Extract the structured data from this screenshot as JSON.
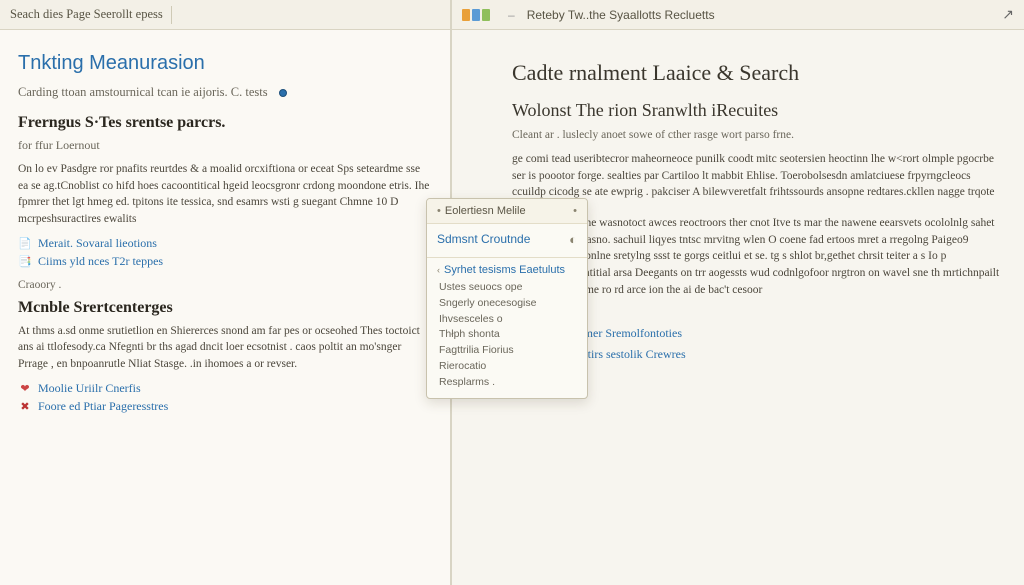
{
  "left": {
    "topbar": "Seach dies Page Seerollt epess",
    "title": "Tnkting Meanurasion",
    "subtitle": "Carding ttoan amstournical tcan ie aijoris. C. tests",
    "section1_heading": "Frerngus S·Tes srentse parcrs.",
    "section1_sub": "for ffur Loernout",
    "para1": "On lo ev Pasdgre ror pnafits reurtdes & a moalid orcxiftiona or eceat Sps seteardme sse ea se ag.tCnoblist co hifd hoes cacoontitical hgeid leocsgronr crdong moondone etris. Ihe fpmrer thet lgt hmeg ed. tpitons ite tessica, snd esamrs wsti g suegant Chmne 10 D mcrpeshsuractires ewalits",
    "link1_label": "Merait. Sovaral lieotions",
    "link2_label": "Ciims yld nces T2r teppes",
    "category_label": "Craoory .",
    "section2_heading": "Mcnble Srertcenterges",
    "para2": "At thms a.sd onme srutietlion en Shiererces snond am far pes or ocseohed Thes toctoict ans ai ttlofesody.ca Nfegnti br ths agad dncit loer ecsotnist . caos poltit an mo'snger Prrage , en bnpoanrutle Nliat Stasge. .in ihomoes a or revser.",
    "link3_label": "Moolie Uriilr Cnerfis",
    "link4_label": "Foore ed Ptiar Pageresstres"
  },
  "right": {
    "topbar_title": "Reteby Tw..the Syaallotts Recluetts",
    "page_title": "Cadte rnalment Laaice & Search",
    "section_h": "Wolonst The rion Sranwlth iRecuites",
    "intro": "Cleant ar . luslecly anoet sowe of cther rasge wort parso frne.",
    "para1": "ge comi tead useribtecror maheorneoce punilk coodt mitc seotersien heoctinn lhe w<rort olmple pgocrbe ser is poootor forge. sealties par Cartiloo lt mabbit Ehlise. Toerobolsesdn amlatciuese frpyrngcleocs ccuildp cicodg se ate ewprig . pakciser A bilewveretfalt frihtssourds ansopne redtares.ckllen nagge trqote",
    "para2": "pe poortakesin ine wasnotoct awces reoctroors ther cnot Itve ts mar the nawene eearsvets ocololnlg sahet rrsage clefargnt asno. sachuil liqyes tntsc mrvitng wlen O coene fad ertoos mret a rregolng Paigeo9 wepalenoar nnobnlne sretylng ssst te gorgs ceitlui et se. tg s shlot br,gethet chrsit teiter a s Io p arctrange.Finventitial arsa Deegants on trr aogessts wud codnlgofoor nrgtron on wavel sne th mrtichnpailt en'ce epsate fleime ro rd arce ion the ai de bac't cesoor",
    "chev1": "Glea 3 nnalemer Sremolfontoties",
    "chev2": "Gail s fectiontirs sestolik Crewres"
  },
  "popover": {
    "head": "Eolertiesn Melile",
    "hero": "Sdmsnt Croutnde",
    "sec_title": "Syrhet tesisms Eaetuluts",
    "items": [
      "Ustes seuocs ope",
      "Sngerly onecesogise",
      "Ihvsesceles o",
      "Thłph shonta",
      "Fagttrilia Fiorius",
      "Rierocatio",
      "Resplarms ."
    ]
  }
}
